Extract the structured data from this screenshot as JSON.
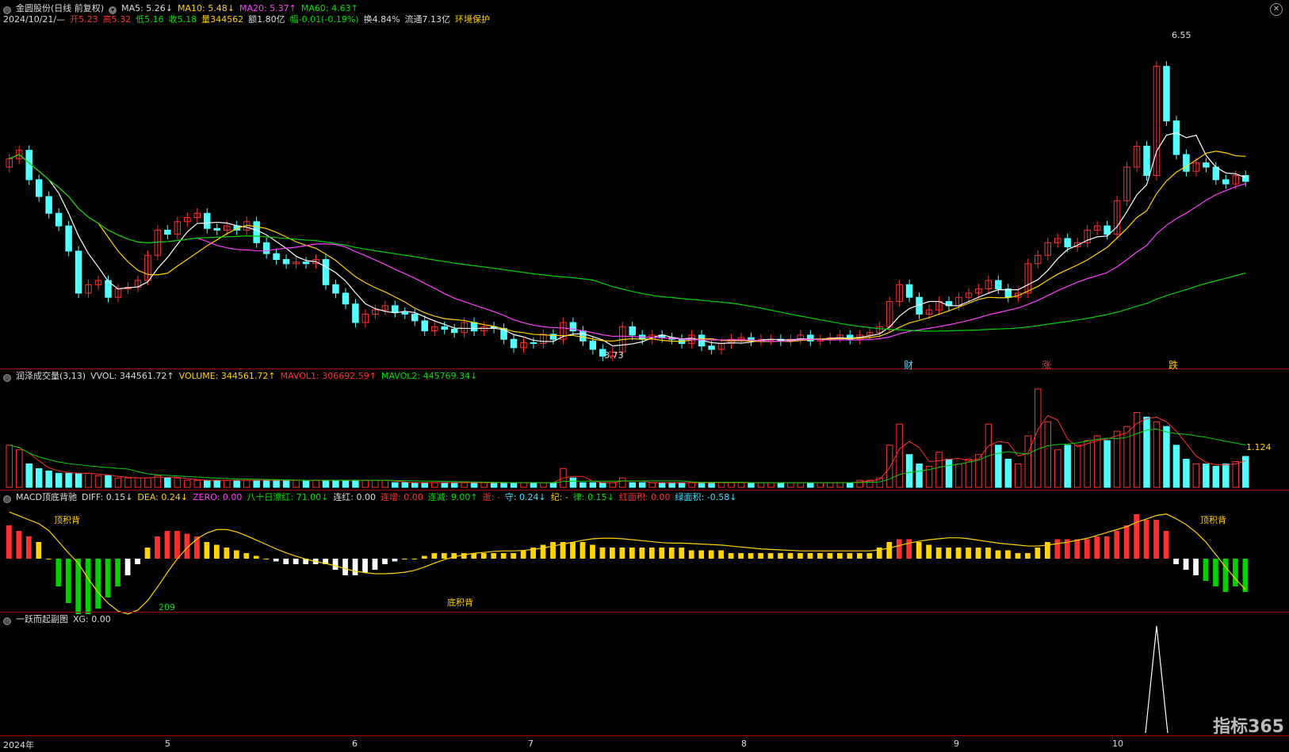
{
  "header": {
    "stock": "金圆股份(日线 前复权)",
    "ma5": "MA5: 5.26↓",
    "ma10": "MA10: 5.48↓",
    "ma20": "MA20: 5.37↑",
    "ma60": "MA60: 4.63↑",
    "date": "2024/10/21/—",
    "open": "开5.23",
    "high": "高5.32",
    "low": "低5.16",
    "close": "收5.18",
    "vol": "量344562",
    "amount": "额1.80亿",
    "change": "幅-0.01(-0.19%)",
    "turnover": "换4.84%",
    "float": "流通7.13亿",
    "tag": "环境保护"
  },
  "volume_header": {
    "name": "润泽成交量(3,13)",
    "vvol": "VVOL: 344561.72↑",
    "volume": "VOLUME: 344561.72↑",
    "mavol1": "MAVOL1: 306692.59↑",
    "mavol2": "MAVOL2: 445769.34↓"
  },
  "macd_header": {
    "name": "MACD顶底背驰",
    "diff": "DIFF: 0.15↓",
    "dea": "DEA: 0.24↓",
    "zero": "ZERO: 0.00",
    "bashi": "八十日漂红: 71.00↓",
    "lianhong": "连红: 0.00",
    "lianzeng": "连增: 0.00",
    "lianjian": "连减: 9.00↑",
    "shi": "逝: -",
    "shou": "守: 0.24↓",
    "ji": "纪: -",
    "lv": "律: 0.15↓",
    "hongmianji": "红面积: 0.00",
    "lvmianji": "绿面积: -0.58↓"
  },
  "sub_header": {
    "name": "一跃而起副图",
    "xg": "XG: 0.00"
  },
  "annotations": {
    "high_price": "6.55",
    "low_price": "3.73",
    "vol_value": "1.124",
    "top_div1": "顶积背",
    "top_div2": "顶积背",
    "bottom_div": "底积背",
    "low_count": "209",
    "marker_cai": "财",
    "marker_zhang": "涨",
    "marker_die": "跌"
  },
  "axis": {
    "labels": [
      "2024年",
      "5",
      "6",
      "7",
      "8",
      "9",
      "10"
    ]
  },
  "logo": "指标365",
  "colors": {
    "up": "#ff3030",
    "down": "#54ffff",
    "ma5": "#ffffff",
    "ma10": "#ffd400",
    "ma20": "#ff40ff",
    "ma60": "#00d000",
    "separator": "#a00000"
  },
  "chart_data": {
    "type": "candlestick",
    "closes": [
      5.45,
      5.55,
      5.2,
      5.0,
      4.8,
      4.65,
      4.35,
      3.85,
      3.95,
      4.0,
      3.8,
      3.9,
      3.92,
      4.0,
      4.3,
      4.6,
      4.55,
      4.7,
      4.75,
      4.8,
      4.62,
      4.6,
      4.65,
      4.6,
      4.7,
      4.45,
      4.32,
      4.25,
      4.2,
      4.22,
      4.2,
      4.25,
      3.95,
      3.85,
      3.72,
      3.5,
      3.6,
      3.65,
      3.7,
      3.62,
      3.6,
      3.52,
      3.4,
      3.45,
      3.42,
      3.38,
      3.5,
      3.4,
      3.45,
      3.43,
      3.3,
      3.2,
      3.26,
      3.25,
      3.36,
      3.3,
      3.5,
      3.4,
      3.28,
      3.18,
      3.1,
      3.15,
      3.45,
      3.35,
      3.3,
      3.35,
      3.32,
      3.3,
      3.25,
      3.35,
      3.22,
      3.18,
      3.25,
      3.3,
      3.32,
      3.28,
      3.3,
      3.3,
      3.28,
      3.3,
      3.35,
      3.28,
      3.3,
      3.32,
      3.35,
      3.3,
      3.35,
      3.38,
      3.45,
      3.75,
      3.95,
      3.8,
      3.6,
      3.65,
      3.75,
      3.7,
      3.8,
      3.85,
      3.9,
      4.0,
      3.9,
      3.8,
      3.85,
      4.2,
      4.3,
      4.45,
      4.5,
      4.4,
      4.45,
      4.6,
      4.65,
      4.55,
      4.95,
      5.35,
      5.6,
      5.25,
      6.55,
      5.9,
      5.5,
      5.3,
      5.4,
      5.35,
      5.2,
      5.15,
      5.25,
      5.18
    ],
    "volumes": [
      0.9,
      0.8,
      0.5,
      0.4,
      0.35,
      0.3,
      0.3,
      0.3,
      0.3,
      0.25,
      0.25,
      0.2,
      0.2,
      0.2,
      0.2,
      0.25,
      0.2,
      0.2,
      0.15,
      0.15,
      0.15,
      0.15,
      0.15,
      0.15,
      0.15,
      0.15,
      0.15,
      0.15,
      0.15,
      0.15,
      0.15,
      0.15,
      0.15,
      0.15,
      0.15,
      0.15,
      0.15,
      0.15,
      0.15,
      0.1,
      0.1,
      0.1,
      0.1,
      0.1,
      0.1,
      0.1,
      0.1,
      0.1,
      0.1,
      0.1,
      0.1,
      0.1,
      0.1,
      0.1,
      0.1,
      0.1,
      0.4,
      0.2,
      0.1,
      0.1,
      0.1,
      0.1,
      0.2,
      0.1,
      0.1,
      0.1,
      0.1,
      0.1,
      0.1,
      0.1,
      0.1,
      0.1,
      0.1,
      0.1,
      0.1,
      0.1,
      0.1,
      0.1,
      0.1,
      0.1,
      0.1,
      0.1,
      0.1,
      0.1,
      0.1,
      0.1,
      0.15,
      0.15,
      0.2,
      0.9,
      1.35,
      0.7,
      0.5,
      0.45,
      0.75,
      0.6,
      0.5,
      0.6,
      0.7,
      1.35,
      0.9,
      0.6,
      0.5,
      1.1,
      2.1,
      1.4,
      0.8,
      0.9,
      0.9,
      1.0,
      1.1,
      1.0,
      1.2,
      1.3,
      1.6,
      1.5,
      1.4,
      1.3,
      0.9,
      0.6,
      0.5,
      0.5,
      0.45,
      0.5,
      0.55,
      0.66
    ],
    "macd": [
      0.06,
      0.05,
      0.04,
      0.03,
      0.0,
      -0.05,
      -0.08,
      -0.1,
      -0.1,
      -0.09,
      -0.07,
      -0.05,
      -0.03,
      -0.01,
      0.02,
      0.04,
      0.05,
      0.05,
      0.045,
      0.04,
      0.03,
      0.025,
      0.02,
      0.015,
      0.01,
      0.005,
      0.0,
      -0.005,
      -0.01,
      -0.01,
      -0.01,
      -0.01,
      -0.01,
      -0.02,
      -0.03,
      -0.03,
      -0.025,
      -0.02,
      -0.01,
      -0.005,
      0.0,
      0.0,
      0.005,
      0.01,
      0.01,
      0.01,
      0.01,
      0.01,
      0.01,
      0.01,
      0.01,
      0.01,
      0.015,
      0.02,
      0.025,
      0.03,
      0.03,
      0.03,
      0.03,
      0.025,
      0.02,
      0.02,
      0.02,
      0.02,
      0.02,
      0.02,
      0.02,
      0.02,
      0.02,
      0.015,
      0.015,
      0.015,
      0.015,
      0.01,
      0.01,
      0.01,
      0.01,
      0.01,
      0.01,
      0.01,
      0.01,
      0.01,
      0.01,
      0.01,
      0.01,
      0.01,
      0.01,
      0.01,
      0.02,
      0.03,
      0.035,
      0.035,
      0.03,
      0.025,
      0.02,
      0.02,
      0.02,
      0.02,
      0.02,
      0.02,
      0.015,
      0.015,
      0.01,
      0.01,
      0.02,
      0.03,
      0.035,
      0.035,
      0.035,
      0.035,
      0.04,
      0.04,
      0.05,
      0.06,
      0.08,
      0.07,
      0.07,
      0.05,
      -0.01,
      -0.02,
      -0.03,
      -0.04,
      -0.05,
      -0.06,
      -0.05,
      -0.06
    ],
    "ylim": [
      3.0,
      7.0
    ]
  }
}
